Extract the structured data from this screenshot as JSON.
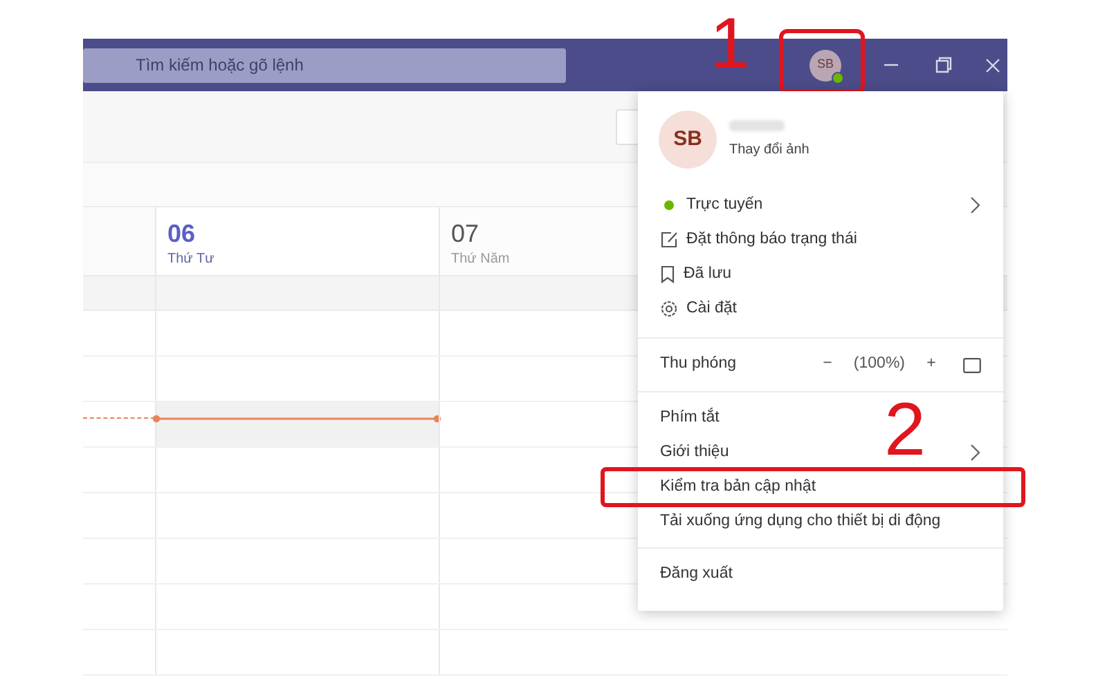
{
  "title_bar": {
    "search": {
      "placeholder": "Tìm kiếm hoặc gõ lệnh"
    },
    "avatar": {
      "initials": "SB",
      "annotation": "1"
    }
  },
  "calendar": {
    "days": [
      {
        "date": "06",
        "weekday": "Thứ Tư",
        "selected": true
      },
      {
        "date": "07",
        "weekday": "Thứ Năm",
        "selected": false
      }
    ]
  },
  "menu": {
    "profile": {
      "initials": "SB",
      "change_photo": "Thay đổi ảnh"
    },
    "sections": [
      [
        {
          "kind": "status",
          "label": "Trực tuyến",
          "color": "#6bb700",
          "has_submenu": true
        },
        {
          "kind": "icon",
          "label": "Đặt thông báo trạng thái",
          "has_submenu": false
        },
        {
          "kind": "icon",
          "label": "Đã lưu",
          "has_submenu": false
        },
        {
          "kind": "icon",
          "label": "Cài đặt",
          "has_submenu": false
        }
      ],
      [
        {
          "kind": "zoom",
          "label": "Thu phóng",
          "minus": "−",
          "value": "(100%)",
          "plus": "+"
        }
      ],
      [
        {
          "kind": "plain",
          "label": "Phím tắt",
          "has_submenu": false
        },
        {
          "kind": "plain",
          "label": "Giới thiệu",
          "has_submenu": true
        },
        {
          "kind": "plain",
          "label": "Kiểm tra bản cập nhật",
          "has_submenu": false,
          "annotation": "2"
        },
        {
          "kind": "plain",
          "label": "Tải xuống ứng dụng cho thiết bị di động",
          "has_submenu": false
        }
      ],
      [
        {
          "kind": "plain",
          "label": "Đăng xuất",
          "has_submenu": false
        }
      ]
    ]
  }
}
